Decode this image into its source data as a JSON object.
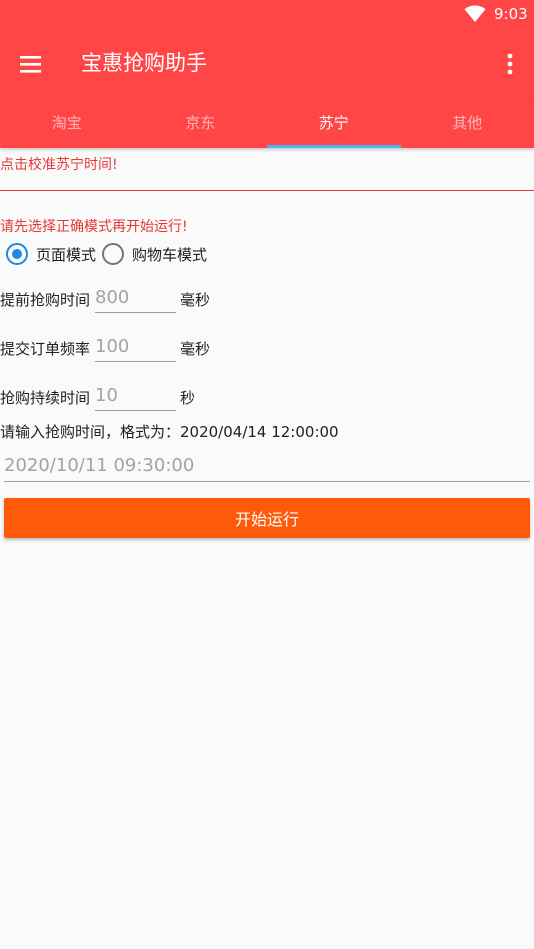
{
  "status_bar": {
    "time": "9:03",
    "icon": "wifi-icon"
  },
  "toolbar": {
    "title": "宝惠抢购助手",
    "menu_icon": "hamburger-menu-icon",
    "overflow_icon": "more-vertical-icon"
  },
  "tabs": [
    {
      "label": "淘宝",
      "active": false
    },
    {
      "label": "京东",
      "active": false
    },
    {
      "label": "苏宁",
      "active": true
    },
    {
      "label": "其他",
      "active": false
    }
  ],
  "calibrate_text": "点击校准苏宁时间!",
  "mode_hint": "请先选择正确模式再开始运行!",
  "modes": [
    {
      "label": "页面模式",
      "checked": true
    },
    {
      "label": "购物车模式",
      "checked": false
    }
  ],
  "fields": {
    "advance": {
      "label": "提前抢购时间",
      "placeholder": "800",
      "unit": "毫秒"
    },
    "frequency": {
      "label": "提交订单频率",
      "placeholder": "100",
      "unit": "毫秒"
    },
    "duration": {
      "label": "抢购持续时间",
      "placeholder": "10",
      "unit": "秒"
    }
  },
  "time_hint": "请输入抢购时间，格式为：2020/04/14 12:00:00",
  "time_input": {
    "placeholder": "2020/10/11 09:30:00"
  },
  "start_button": "开始运行",
  "colors": {
    "primary": "#ff4545",
    "accent_indicator": "#4db6f0",
    "warning_text": "#e53935",
    "radio_checked": "#1e88e5",
    "button": "#ff5a0a"
  }
}
